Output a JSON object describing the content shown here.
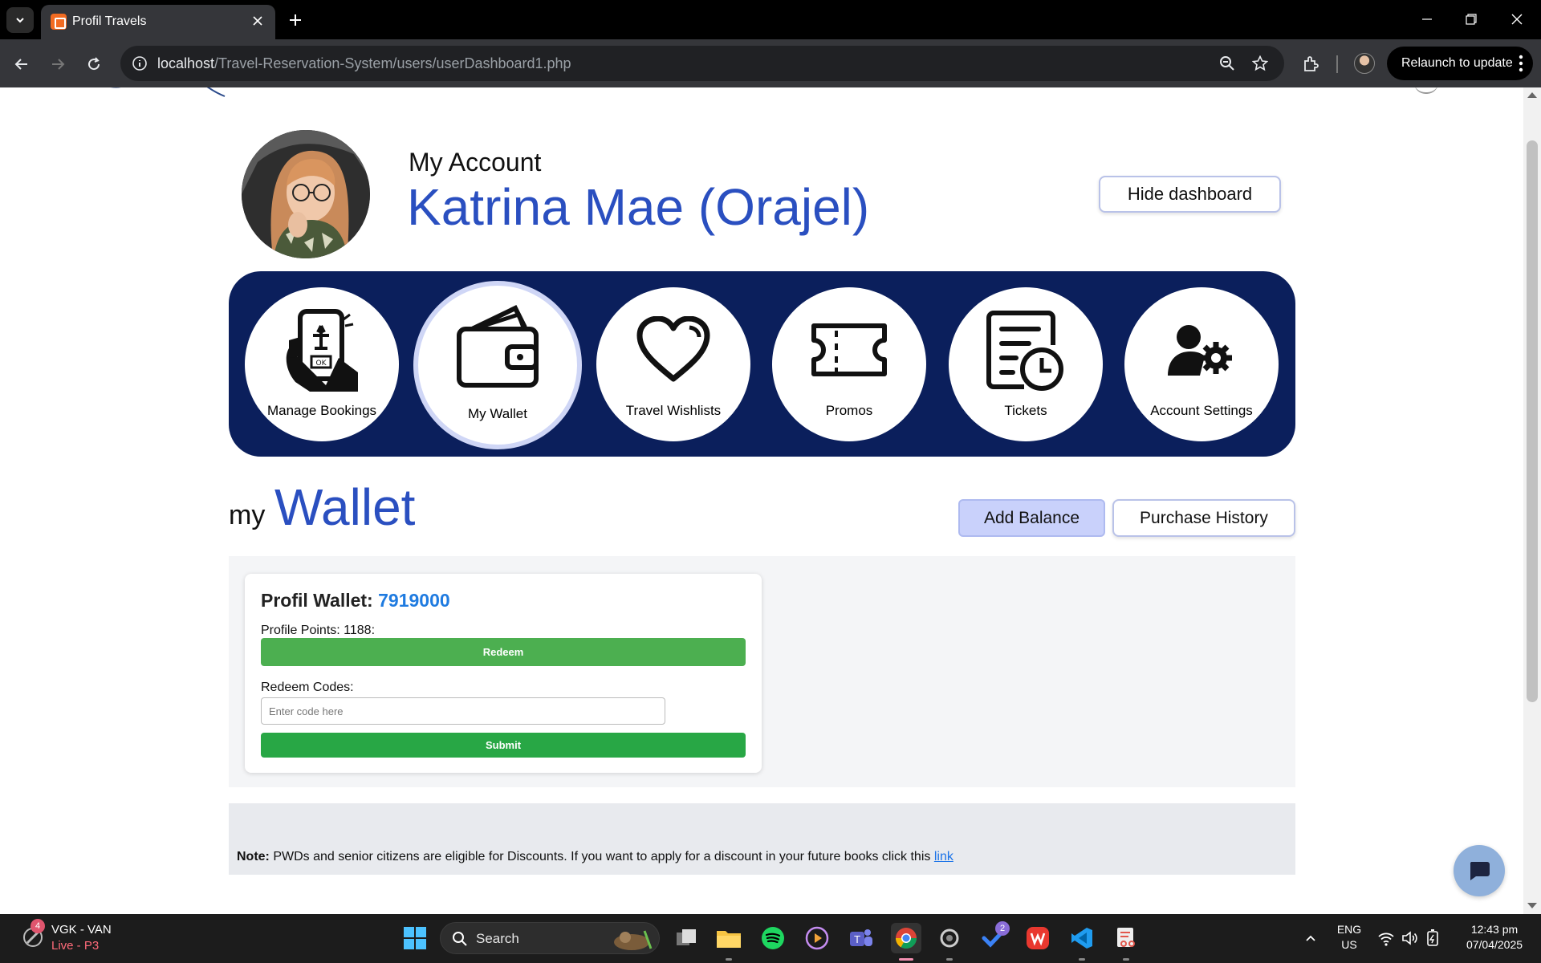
{
  "browser": {
    "tab_title": "Profil Travels",
    "url_host": "localhost",
    "url_path": "/Travel-Reservation-System/users/userDashboard1.php",
    "relaunch_label": "Relaunch to update"
  },
  "header": {
    "account_label": "My Account",
    "user_name": "Katrina Mae (Orajel)",
    "hide_dashboard_label": "Hide dashboard"
  },
  "menu": {
    "items": [
      {
        "label": "Manage Bookings",
        "icon": "phone-booking-icon"
      },
      {
        "label": "My Wallet",
        "icon": "wallet-icon",
        "active": true
      },
      {
        "label": "Travel Wishlists",
        "icon": "heart-icon"
      },
      {
        "label": "Promos",
        "icon": "ticket-coupon-icon"
      },
      {
        "label": "Tickets",
        "icon": "document-clock-icon"
      },
      {
        "label": "Account Settings",
        "icon": "user-gear-icon"
      }
    ]
  },
  "wallet": {
    "title_prefix": "my",
    "title": "Wallet",
    "add_balance_label": "Add Balance",
    "purchase_history_label": "Purchase History",
    "card_title_prefix": "Profil Wallet:",
    "balance": "7919000",
    "points_text": "Profile Points: 1188:",
    "redeem_label": "Redeem",
    "codes_label": "Redeem Codes:",
    "code_placeholder": "Enter code here",
    "submit_label": "Submit"
  },
  "note": {
    "label": "Note:",
    "text": " PWDs and senior citizens are eligible for Discounts. If you want to apply for a discount in your future books click this ",
    "link_text": "link"
  },
  "taskbar": {
    "weather_title": "VGK - VAN",
    "weather_sub": "Live - P3",
    "weather_badge": "4",
    "search_label": "Search",
    "todo_badge": "2",
    "lang_1": "ENG",
    "lang_2": "US",
    "time": "12:43 pm",
    "date": "07/04/2025"
  },
  "colors": {
    "accent_blue": "#2a4fc0",
    "menu_band": "#0b1f5c",
    "green_button": "#4caf50",
    "balance_blue": "#1f7be0"
  }
}
